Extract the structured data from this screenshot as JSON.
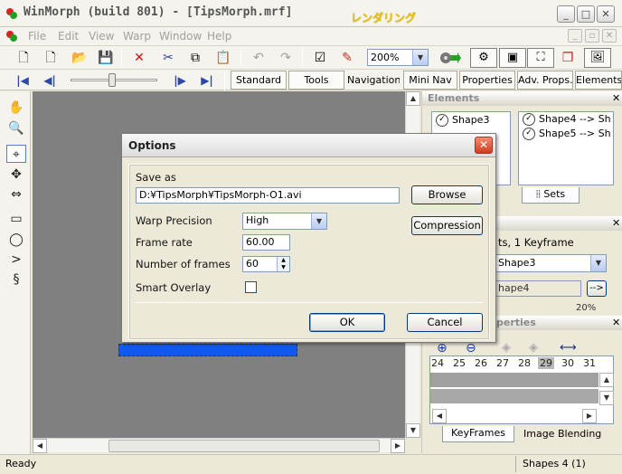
{
  "window": {
    "title": "WinMorph (build 801) - [TipsMorph.mrf]",
    "annotation": "レンダリング"
  },
  "menu": [
    "File",
    "Edit",
    "View",
    "Warp",
    "Window",
    "Help"
  ],
  "toolbar": {
    "zoom_value": "200%"
  },
  "nav_tabs": [
    "Standard",
    "Tools",
    "Navigation",
    "Mini Nav",
    "Properties",
    "Adv. Props.",
    "Elements"
  ],
  "elements_panel": {
    "title": "Elements",
    "items": [
      "Shape3",
      "Shape4 --> Sh",
      "Shape5 --> Sh"
    ],
    "sets_tab": "Sets"
  },
  "element_props": {
    "summary": "ts, 1 Keyframe",
    "shape_select": "Shape3",
    "shape_field": "hape4",
    "arrow_btn": "-->",
    "percent": "20%"
  },
  "keyframe_panel": {
    "title": "perties",
    "frames": [
      "24",
      "25",
      "26",
      "27",
      "28",
      "29",
      "30",
      "31"
    ],
    "selected_frame": "29",
    "tabs": [
      "KeyFrames",
      "Image Blending"
    ]
  },
  "statusbar": {
    "left": "Ready",
    "right": "Shapes 4 (1)"
  },
  "dialog": {
    "title": "Options",
    "save_as_label": "Save as",
    "save_as_value": "D:¥TipsMorph¥TipsMorph-O1.avi",
    "browse_label": "Browse",
    "compression_label": "Compression",
    "warp_precision_label": "Warp Precision",
    "warp_precision_value": "High",
    "frame_rate_label": "Frame rate",
    "frame_rate_value": "60.00",
    "num_frames_label": "Number of frames",
    "num_frames_value": "60",
    "smart_overlay_label": "Smart Overlay",
    "smart_overlay_checked": false,
    "ok_label": "OK",
    "cancel_label": "Cancel"
  }
}
